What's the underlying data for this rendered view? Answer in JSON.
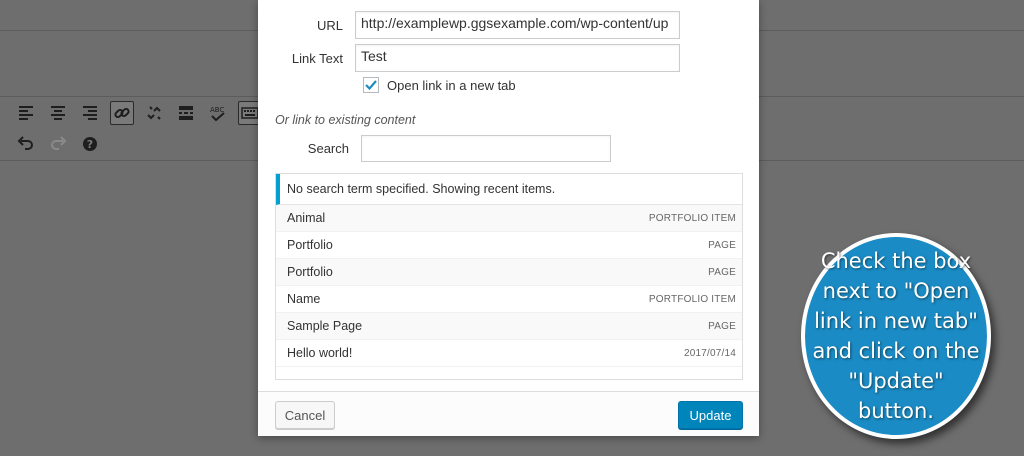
{
  "link_dialog": {
    "url_label": "URL",
    "url_value": "http://examplewp.ggsexample.com/wp-content/up",
    "link_text_label": "Link Text",
    "link_text_value": "Test",
    "new_tab_label": "Open link in a new tab",
    "new_tab_checked": true,
    "existing_content_title": "Or link to existing content",
    "search_label": "Search",
    "search_value": "",
    "notice": "No search term specified. Showing recent items.",
    "results": [
      {
        "title": "Animal",
        "info": "PORTFOLIO ITEM"
      },
      {
        "title": "Portfolio",
        "info": "PAGE"
      },
      {
        "title": "Portfolio",
        "info": "PAGE"
      },
      {
        "title": "Name",
        "info": "PORTFOLIO ITEM"
      },
      {
        "title": "Sample Page",
        "info": "PAGE"
      },
      {
        "title": "Hello world!",
        "info": "2017/07/14"
      }
    ],
    "cancel_label": "Cancel",
    "update_label": "Update"
  },
  "editor_toolbar": {
    "row1_icons": [
      "align-left-icon",
      "align-center-icon",
      "align-right-icon",
      "link-icon",
      "unlink-icon",
      "read-more-icon",
      "spellcheck-icon",
      "keyboard-icon"
    ],
    "row2_icons": [
      "undo-icon",
      "redo-icon",
      "help-icon"
    ]
  },
  "callout": {
    "text": "Check the box next to \"Open link in new tab\" and click on the \"Update\" button."
  },
  "colors": {
    "accent": "#0085ba",
    "notice_border": "#00a0d2",
    "callout_bg": "#1a8bc4",
    "overlay": "#6e6e6e"
  }
}
